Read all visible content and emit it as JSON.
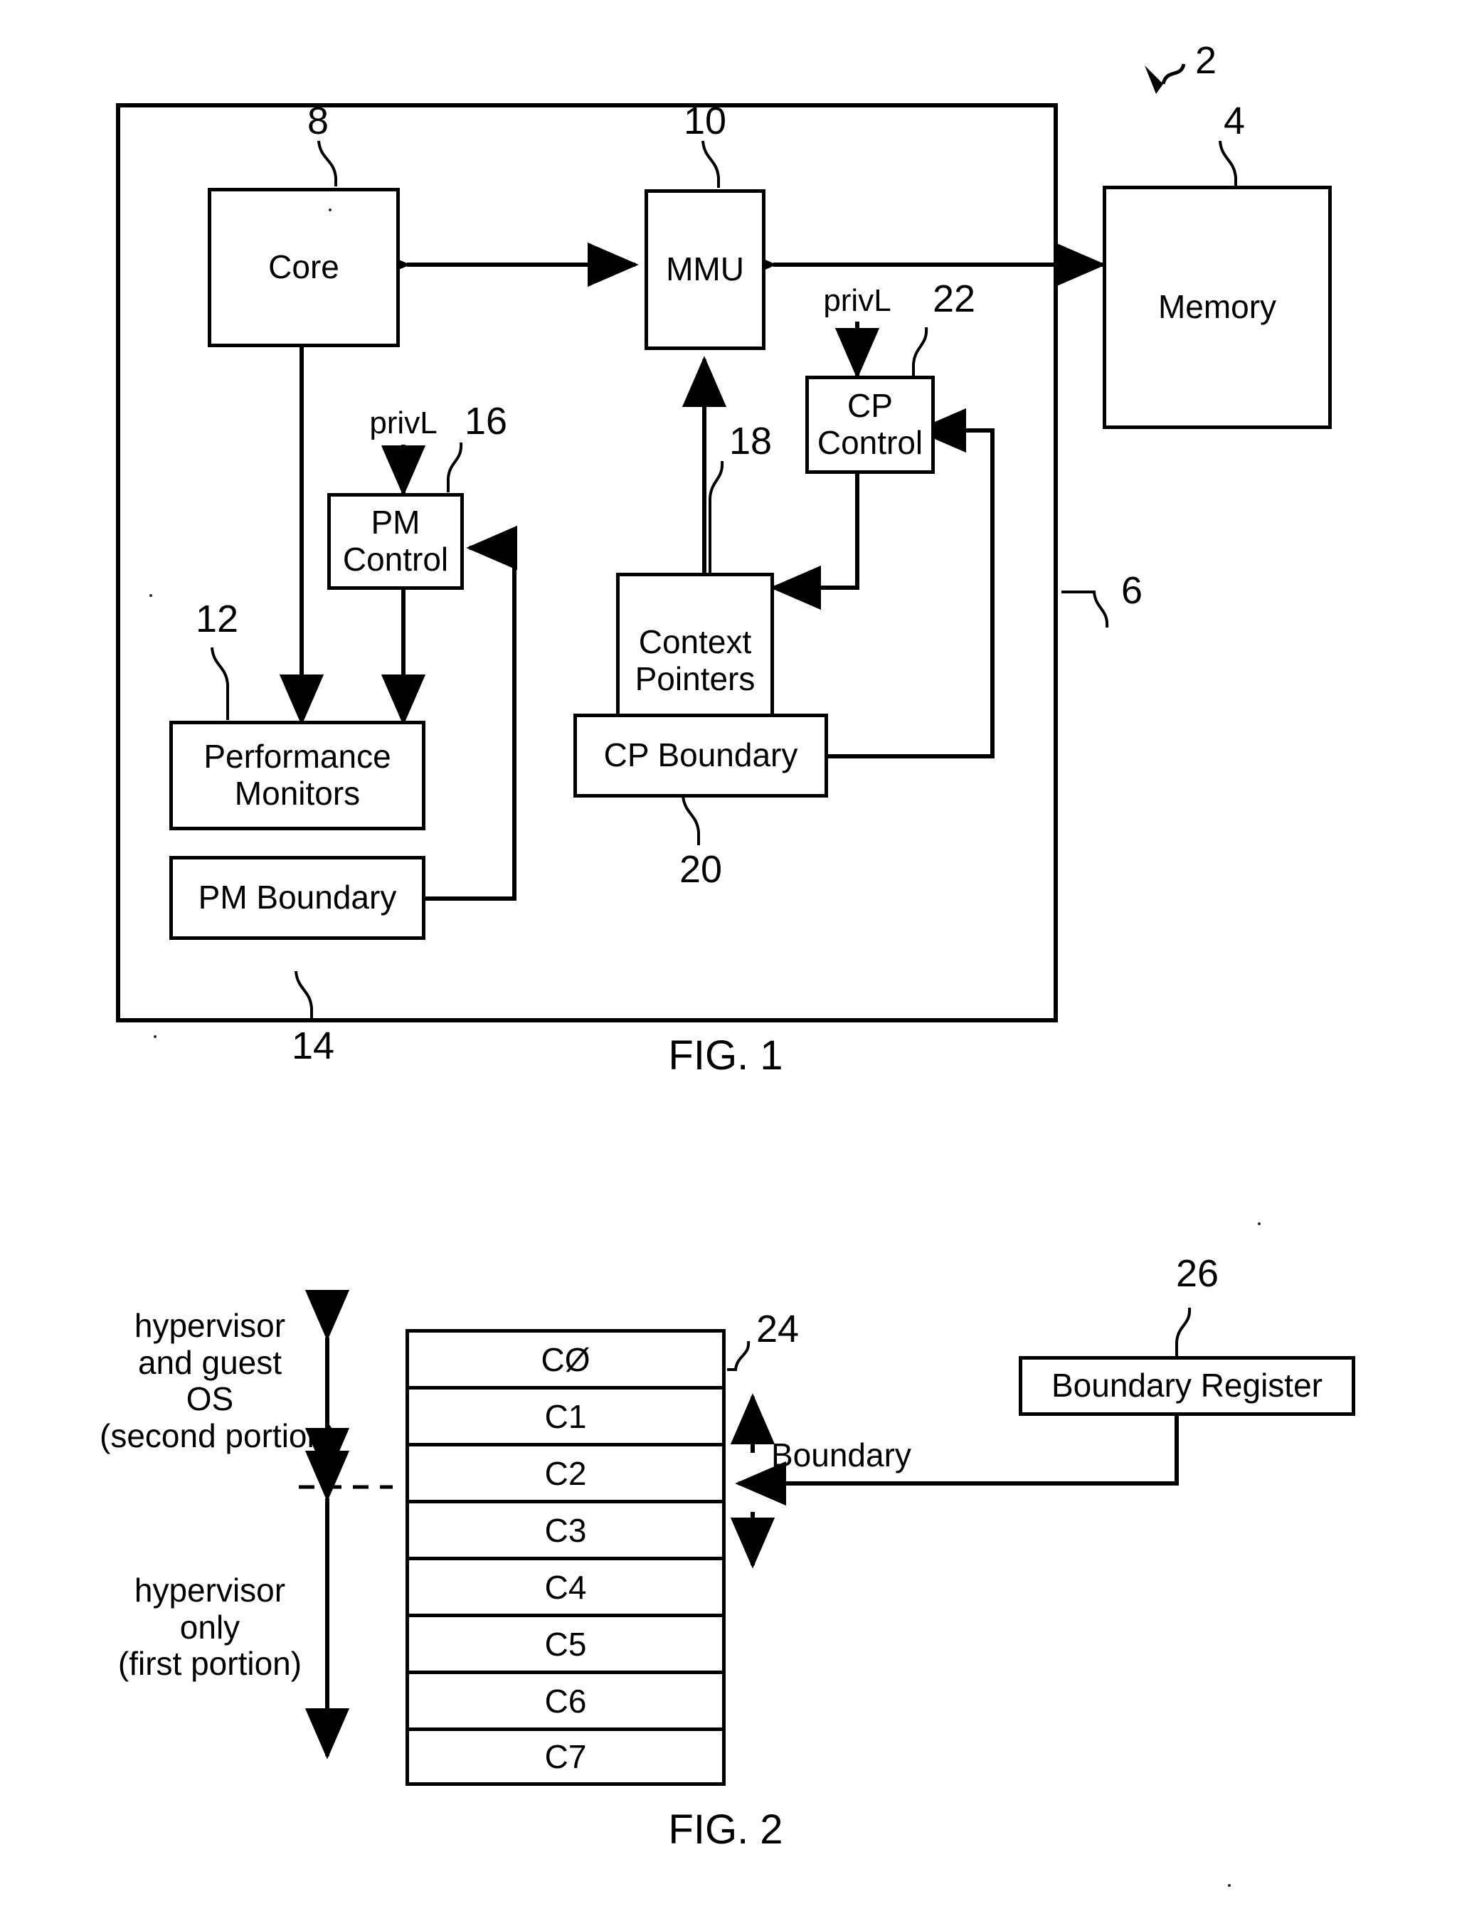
{
  "figure1": {
    "caption": "FIG. 1",
    "system_ref": "2",
    "chip_ref": "6",
    "blocks": {
      "core": {
        "label": "Core",
        "ref": "8"
      },
      "mmu": {
        "label": "MMU",
        "ref": "10"
      },
      "memory": {
        "label": "Memory",
        "ref": "4"
      },
      "pm_control": {
        "label": "PM\nControl",
        "ref": "16"
      },
      "perf_mon": {
        "label": "Performance\nMonitors",
        "ref": "12"
      },
      "pm_boundary": {
        "label": "PM Boundary",
        "ref": "14"
      },
      "context_ptr": {
        "label": "Context\nPointers",
        "ref": "18"
      },
      "cp_control": {
        "label": "CP\nControl",
        "ref": "22"
      },
      "cp_boundary": {
        "label": "CP Boundary",
        "ref": "20"
      }
    },
    "signals": {
      "privl_pm": "privL",
      "privl_cp": "privL"
    }
  },
  "figure2": {
    "caption": "FIG. 2",
    "table": {
      "ref": "24",
      "rows": [
        "CØ",
        "C1",
        "C2",
        "C3",
        "C4",
        "C5",
        "C6",
        "C7"
      ]
    },
    "boundary_register": {
      "label": "Boundary Register",
      "ref": "26"
    },
    "boundary_label": "Boundary",
    "region_upper": "hypervisor\nand guest\nOS\n(second portion)",
    "region_lower": "hypervisor\nonly\n(first portion)"
  }
}
